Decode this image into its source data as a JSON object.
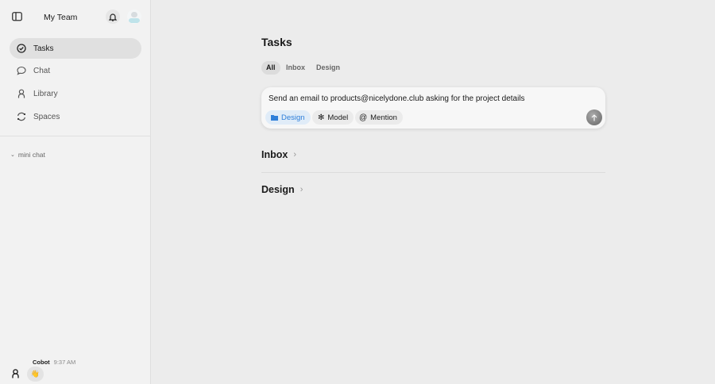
{
  "sidebar": {
    "team_name": "My Team",
    "nav": [
      {
        "label": "Tasks",
        "icon": "check-circle-icon",
        "active": true
      },
      {
        "label": "Chat",
        "icon": "chat-bubble-icon"
      },
      {
        "label": "Library",
        "icon": "person-icon"
      },
      {
        "label": "Spaces",
        "icon": "refresh-icon"
      }
    ],
    "mini_chat_label": "mini chat",
    "message": {
      "author": "Cobot",
      "time": "9:37 AM",
      "content": "👋"
    }
  },
  "main": {
    "title": "Tasks",
    "tabs": [
      {
        "label": "All",
        "active": true
      },
      {
        "label": "Inbox"
      },
      {
        "label": "Design"
      }
    ],
    "composer": {
      "text": "Send an email to products@nicelydone.club asking for the project details",
      "chips": {
        "design": "Design",
        "model": "Model",
        "mention": "Mention"
      },
      "accent": "#2f7fd9"
    },
    "sections": [
      {
        "label": "Inbox"
      },
      {
        "label": "Design"
      }
    ]
  }
}
